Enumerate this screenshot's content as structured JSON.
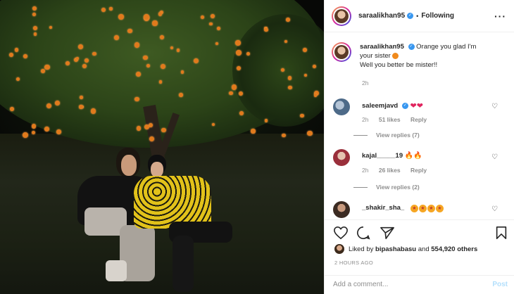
{
  "post": {
    "username": "saraalikhan95",
    "follow_separator": "•",
    "follow_label": "Following",
    "more_icon": "more-horizontal-icon",
    "caption_line1": "Orange you glad I'm",
    "caption_line2": "your sister",
    "caption_line3": "Well you better be mister!!",
    "caption_time": "2h"
  },
  "comments": [
    {
      "username": "saleemjavd",
      "verified": true,
      "emoji": "❤❤",
      "time": "2h",
      "likes": "51 likes",
      "reply": "Reply",
      "view_replies": "View replies (7)"
    },
    {
      "username": "kajal_____19",
      "verified": false,
      "emoji": "🔥🔥",
      "time": "2h",
      "likes": "26 likes",
      "reply": "Reply",
      "view_replies": "View replies (2)"
    },
    {
      "username": "_shakir_sha_",
      "verified": false,
      "emoji": ""
    }
  ],
  "actions": {
    "liked_by_prefix": "Liked by",
    "liked_by_user": "bipashabasu",
    "liked_by_and": "and",
    "liked_by_others": "554,920 others",
    "posted_time": "2 HOURS AGO"
  },
  "add_comment": {
    "placeholder": "Add a comment...",
    "post_label": "Post"
  },
  "colors": {
    "verified": "#3897f0",
    "muted": "#8e8e8e",
    "post_button": "#b2dffc",
    "orange": "#e07a1c"
  }
}
